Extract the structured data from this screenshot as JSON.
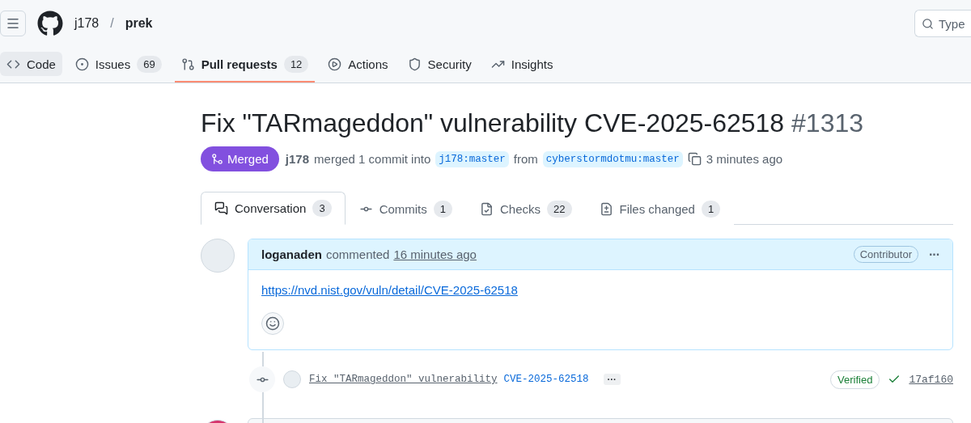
{
  "header": {
    "owner": "j178",
    "separator": "/",
    "repo": "prek",
    "search_placeholder": "Type"
  },
  "repo_tabs": [
    {
      "kind": "code",
      "label": "Code",
      "highlighted": true,
      "selected": false
    },
    {
      "kind": "issues",
      "label": "Issues",
      "count": "69",
      "highlighted": false,
      "selected": false
    },
    {
      "kind": "pulls",
      "label": "Pull requests",
      "count": "12",
      "highlighted": false,
      "selected": true
    },
    {
      "kind": "actions",
      "label": "Actions",
      "highlighted": false,
      "selected": false
    },
    {
      "kind": "security",
      "label": "Security",
      "highlighted": false,
      "selected": false
    },
    {
      "kind": "insights",
      "label": "Insights",
      "highlighted": false,
      "selected": false
    }
  ],
  "pr": {
    "title": "Fix \"TARmageddon\" vulnerability CVE-2025-62518",
    "number": "#1313",
    "kind": "merged",
    "state_label": "Merged",
    "author": "j178",
    "summary": "merged 1 commit into",
    "base": "j178:master",
    "from": "from",
    "head": "cyberstormdotmu:master",
    "time": "3 minutes ago"
  },
  "pr_tabs": [
    {
      "kind": "conversation",
      "label": "Conversation",
      "count": "3",
      "selected": true
    },
    {
      "kind": "commits",
      "label": "Commits",
      "count": "1",
      "selected": false
    },
    {
      "kind": "checks",
      "label": "Checks",
      "count": "22",
      "selected": false
    },
    {
      "kind": "files",
      "label": "Files changed",
      "count": "1",
      "selected": false
    }
  ],
  "comment": {
    "author": "loganaden",
    "action": "commented",
    "time": "16 minutes ago",
    "badge": "Contributor",
    "menu": "···",
    "link": "https://nvd.nist.gov/vuln/detail/CVE-2025-62518"
  },
  "commit": {
    "message": "Fix \"TARmageddon\" vulnerability",
    "ref": "CVE-2025-62518",
    "more": "···",
    "verified": "Verified",
    "sha": "17af160"
  }
}
